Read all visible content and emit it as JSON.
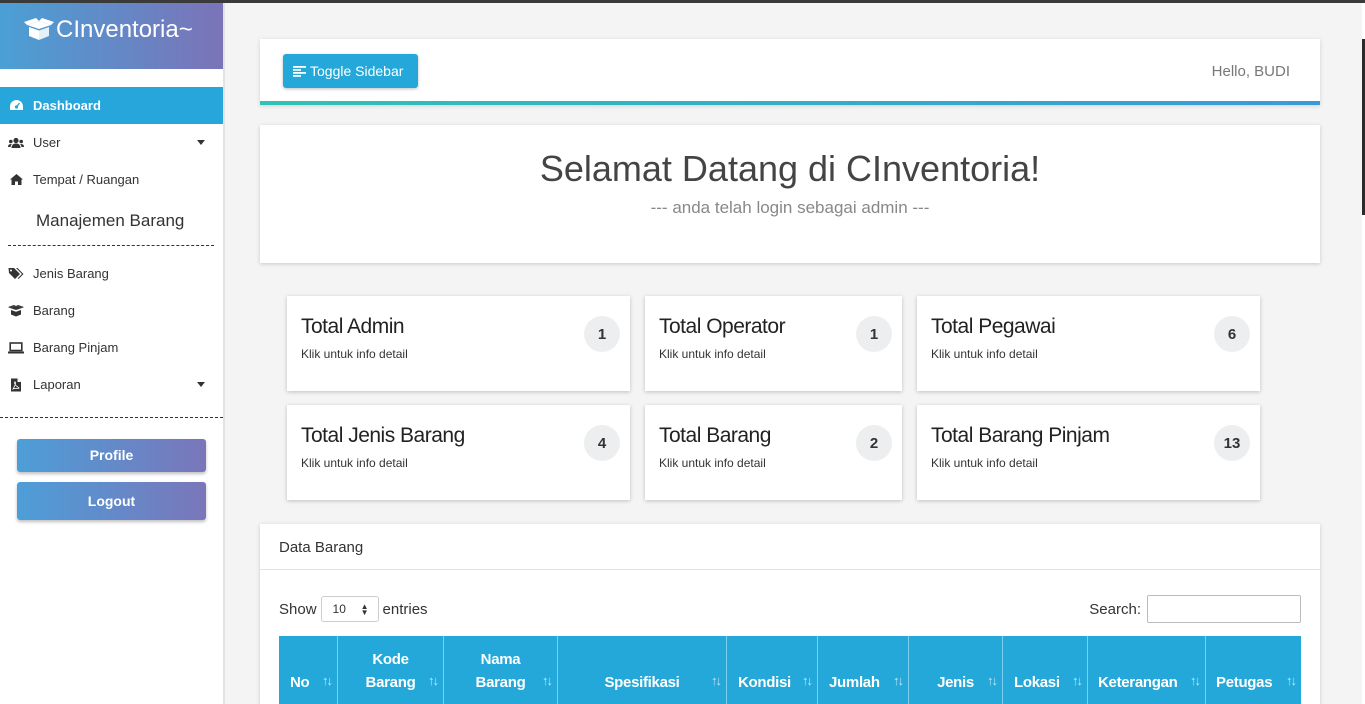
{
  "brand": {
    "name": "CInventoria~",
    "icon": "box-open-icon"
  },
  "sidebar": {
    "items": [
      {
        "label": "Dashboard",
        "icon": "dashboard-icon",
        "active": true
      },
      {
        "label": "User",
        "icon": "users-icon",
        "dropdown": true
      },
      {
        "label": "Tempat / Ruangan",
        "icon": "home-icon"
      }
    ],
    "section_title": "Manajemen Barang",
    "items2": [
      {
        "label": "Jenis Barang",
        "icon": "tags-icon"
      },
      {
        "label": "Barang",
        "icon": "box-icon"
      },
      {
        "label": "Barang Pinjam",
        "icon": "laptop-icon"
      },
      {
        "label": "Laporan",
        "icon": "file-pdf-icon",
        "dropdown": true
      }
    ],
    "profile_label": "Profile",
    "logout_label": "Logout"
  },
  "header": {
    "toggle_label": "Toggle Sidebar",
    "greeting": "Hello, BUDI"
  },
  "welcome": {
    "title": "Selamat Datang di CInventoria!",
    "subtitle": "--- anda telah login sebagai admin ---"
  },
  "cards": [
    {
      "title": "Total Admin",
      "subtitle": "Klik untuk info detail",
      "count": "1"
    },
    {
      "title": "Total Operator",
      "subtitle": "Klik untuk info detail",
      "count": "1"
    },
    {
      "title": "Total Pegawai",
      "subtitle": "Klik untuk info detail",
      "count": "6"
    },
    {
      "title": "Total Jenis Barang",
      "subtitle": "Klik untuk info detail",
      "count": "4"
    },
    {
      "title": "Total Barang",
      "subtitle": "Klik untuk info detail",
      "count": "2"
    },
    {
      "title": "Total Barang Pinjam",
      "subtitle": "Klik untuk info detail",
      "count": "13"
    }
  ],
  "table": {
    "title": "Data Barang",
    "show_label": "Show",
    "entries_value": "10",
    "entries_label": "entries",
    "search_label": "Search:",
    "search_value": "",
    "columns": [
      "No",
      "Kode Barang",
      "Nama Barang",
      "Spesifikasi",
      "Kondisi",
      "Jumlah",
      "Jenis",
      "Lokasi",
      "Keterangan",
      "Petugas"
    ]
  },
  "colors": {
    "accent": "#23a8d9",
    "gradient_start": "#4aa0d5",
    "gradient_end": "#7b73b8"
  }
}
